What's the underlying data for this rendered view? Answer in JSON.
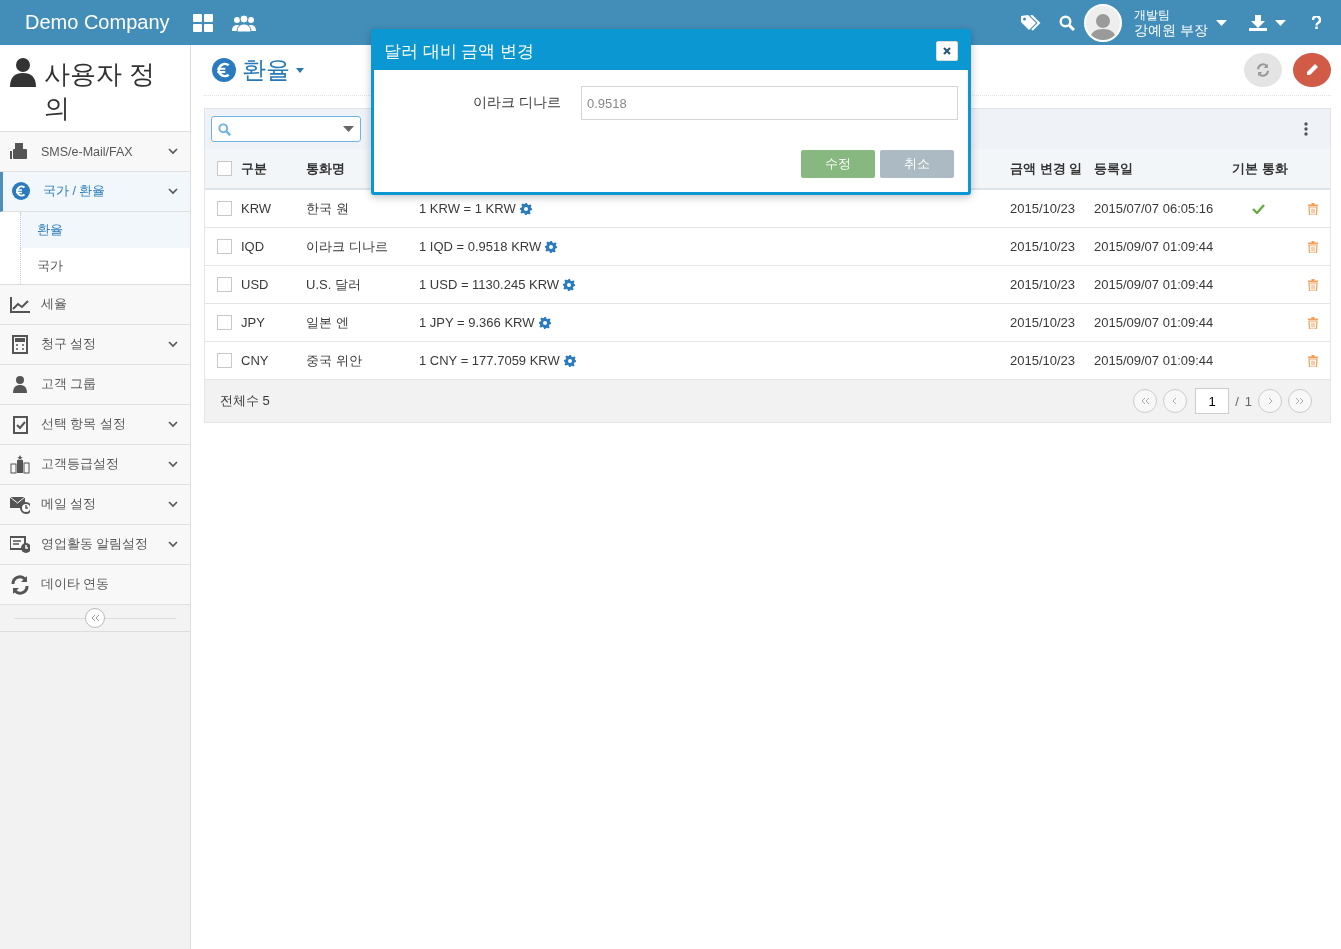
{
  "topbar": {
    "brand": "Demo Company",
    "user": {
      "team": "개발팀",
      "name": "강예원 부장"
    }
  },
  "sidebar": {
    "title": "사용자 정의",
    "items": [
      {
        "label": "SMS/e-Mail/FAX",
        "has_submenu": true,
        "selected": false
      },
      {
        "label": "국가 / 환율",
        "has_submenu": true,
        "selected": true,
        "children": [
          {
            "label": "환율",
            "selected": true
          },
          {
            "label": "국가",
            "selected": false
          }
        ]
      },
      {
        "label": "세율",
        "has_submenu": false,
        "selected": false
      },
      {
        "label": "청구 설정",
        "has_submenu": true,
        "selected": false
      },
      {
        "label": "고객 그룹",
        "has_submenu": false,
        "selected": false
      },
      {
        "label": "선택 항목 설정",
        "has_submenu": true,
        "selected": false
      },
      {
        "label": "고객등급설정",
        "has_submenu": true,
        "selected": false
      },
      {
        "label": "메일 설정",
        "has_submenu": true,
        "selected": false
      },
      {
        "label": "영업활동 알림설정",
        "has_submenu": true,
        "selected": false
      },
      {
        "label": "데이타 연동",
        "has_submenu": false,
        "selected": false
      }
    ]
  },
  "page": {
    "title": "환율"
  },
  "table": {
    "all_checked": false,
    "columns": [
      "구분",
      "통화명",
      "금액 변경 일",
      "등록일",
      "기본 통화"
    ],
    "rows": [
      {
        "checked": false,
        "code": "KRW",
        "name": "한국 원",
        "rate": "1 KRW = 1 KRW",
        "changed": "2015/10/23",
        "registered": "2015/07/07 06:05:16",
        "default": true
      },
      {
        "checked": false,
        "code": "IQD",
        "name": "이라크 디나르",
        "rate": "1 IQD = 0.9518 KRW",
        "changed": "2015/10/23",
        "registered": "2015/09/07 01:09:44",
        "default": false
      },
      {
        "checked": false,
        "code": "USD",
        "name": "U.S. 달러",
        "rate": "1 USD = 1130.245 KRW",
        "changed": "2015/10/23",
        "registered": "2015/09/07 01:09:44",
        "default": false
      },
      {
        "checked": false,
        "code": "JPY",
        "name": "일본 엔",
        "rate": "1 JPY = 9.366 KRW",
        "changed": "2015/10/23",
        "registered": "2015/09/07 01:09:44",
        "default": false
      },
      {
        "checked": false,
        "code": "CNY",
        "name": "중국 위안",
        "rate": "1 CNY = 177.7059 KRW",
        "changed": "2015/10/23",
        "registered": "2015/09/07 01:09:44",
        "default": false
      }
    ],
    "total": "전체수 5",
    "pagination": {
      "page": "1",
      "separator": "/",
      "pages": "1"
    }
  },
  "modal": {
    "title": "달러 대비 금액 변경",
    "field_label": "이라크 디나르",
    "field_value": "0.9518",
    "buttons": [
      {
        "label": "수정",
        "kind": "primary"
      },
      {
        "label": "취소",
        "kind": "cancel"
      }
    ]
  }
}
